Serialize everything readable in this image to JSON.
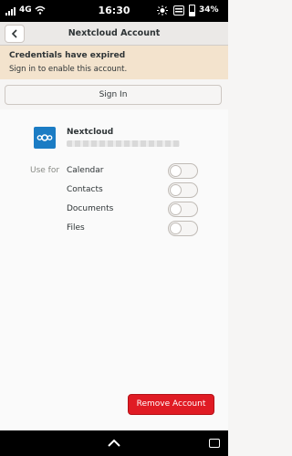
{
  "status_bar": {
    "network": "4G",
    "time": "16:30",
    "battery": "34%"
  },
  "header": {
    "title": "Nextcloud Account"
  },
  "infobar": {
    "heading": "Credentials have expired",
    "message": "Sign in to enable this account."
  },
  "sign_in_label": "Sign In",
  "account": {
    "provider": "Nextcloud"
  },
  "use_for_label": "Use for",
  "services": [
    {
      "label": "Calendar",
      "enabled": false
    },
    {
      "label": "Contacts",
      "enabled": false
    },
    {
      "label": "Documents",
      "enabled": false
    },
    {
      "label": "Files",
      "enabled": false
    }
  ],
  "remove_label": "Remove Account",
  "colors": {
    "accent": "#1b7cc4",
    "destructive": "#e01b24",
    "infobar": "#f3e3cd"
  }
}
